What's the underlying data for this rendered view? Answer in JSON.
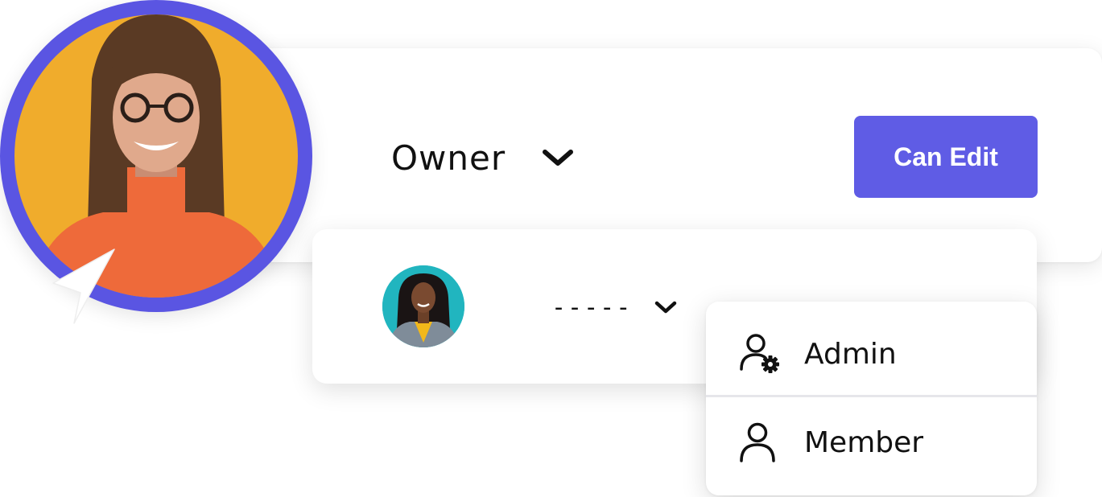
{
  "permission": {
    "role_label": "Owner",
    "role_dropdown_icon": "chevron-down-icon",
    "action_button_label": "Can Edit"
  },
  "member_row": {
    "role_value": "-----",
    "role_dropdown_icon": "chevron-down-icon"
  },
  "role_menu": {
    "items": [
      {
        "label": "Admin",
        "icon": "user-gear-icon"
      },
      {
        "label": "Member",
        "icon": "user-icon"
      }
    ]
  },
  "colors": {
    "accent": "#5f5ce5",
    "avatar_ring": "#5a55e2",
    "avatar_bg_main": "#f0ac2c",
    "avatar_bg_small": "#21b5bf"
  }
}
